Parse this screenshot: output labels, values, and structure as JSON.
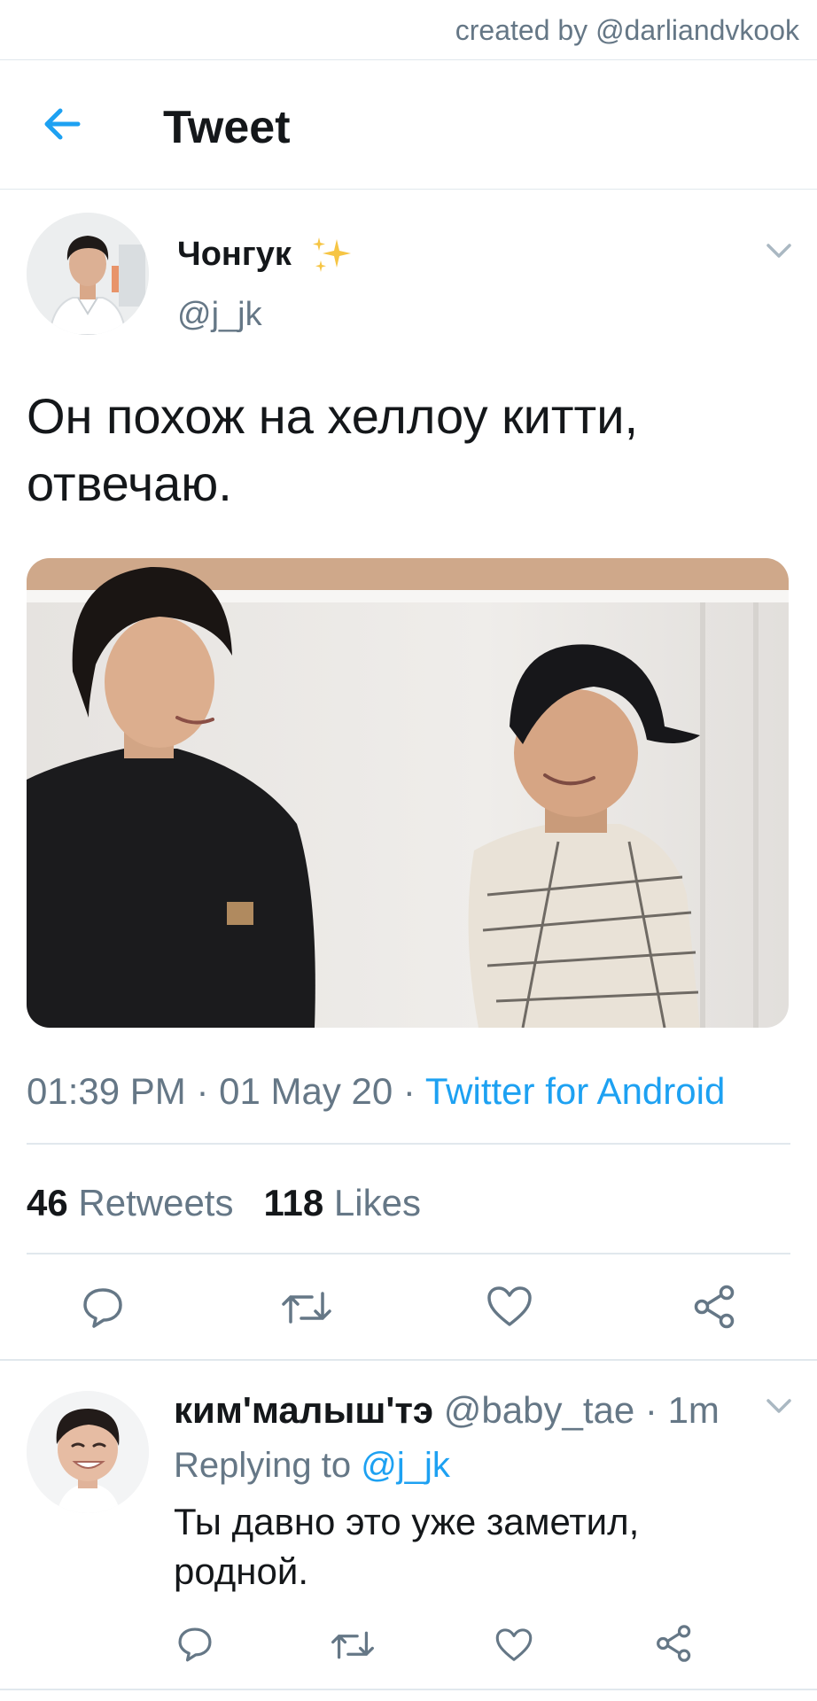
{
  "credit": "created by @darliandvkook",
  "header": {
    "title": "Tweet"
  },
  "tweet": {
    "author_name": "Чонгук",
    "author_handle": "@j_jk",
    "text_line1": "Он похож на хеллоу китти,",
    "text_line2": "отвечаю.",
    "time": "01:39 PM",
    "date": "01 May 20",
    "separator": "·",
    "source": "Twitter for Android",
    "retweets_count": "46",
    "retweets_label": "Retweets",
    "likes_count": "118",
    "likes_label": "Likes"
  },
  "reply": {
    "name": "ким'малыш'тэ",
    "handle": "@baby_tae",
    "time_ago": "1m",
    "replying_prefix": "Replying to",
    "replying_handle": "@j_jk",
    "text_line1": "Ты давно это уже заметил,",
    "text_line2": "родной."
  },
  "icons": {
    "back": "arrow-left-icon",
    "caret": "chevron-down-icon",
    "reply": "comment-icon",
    "retweet": "retweet-icon",
    "like": "heart-icon",
    "share": "share-icon"
  },
  "colors": {
    "accent": "#1da1f2",
    "text": "#14171a",
    "muted": "#657786",
    "divider": "#e1e8ed"
  }
}
